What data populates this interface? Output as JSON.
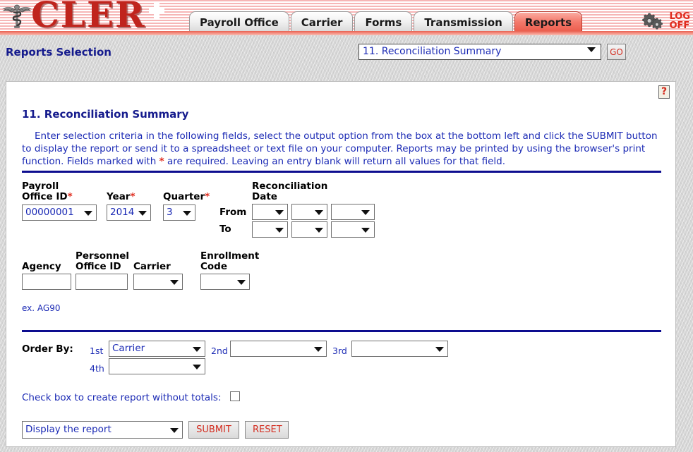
{
  "header": {
    "logo_text": "CLER",
    "caduceus_icon": "caduceus-icon",
    "tabs": [
      {
        "label": "Payroll Office",
        "active": false
      },
      {
        "label": "Carrier",
        "active": false
      },
      {
        "label": "Forms",
        "active": false
      },
      {
        "label": "Transmission",
        "active": false
      },
      {
        "label": "Reports",
        "active": true
      }
    ],
    "gears_icon": "gears-icon",
    "logoff_line1": "LOG",
    "logoff_line2": "OFF"
  },
  "subbar": {
    "title": "Reports Selection",
    "report_select_value": "11. Reconciliation Summary",
    "go_label": "GO"
  },
  "panel": {
    "help_label": "?",
    "title": "11. Reconciliation Summary",
    "intro_part1": "Enter selection criteria in the following fields, select the output option from the box at the bottom left and click the SUBMIT button to display the report or send it to a spreadsheet or text file on your computer.  Reports may be printed by using the browser's print function.  Fields marked with ",
    "intro_asterisk": "*",
    "intro_part2": " are required.  Leaving an entry blank will return all values for that field."
  },
  "criteria": {
    "payroll_office_label_line1": "Payroll",
    "payroll_office_label_line2": "Office ID",
    "payroll_office_value": "00000001",
    "year_label": "Year",
    "year_value": "2014",
    "quarter_label": "Quarter",
    "quarter_value": "3",
    "recon_date_label_line1": "Reconciliation",
    "recon_date_label_line2": "Date",
    "from_label": "From",
    "to_label": "To",
    "from_month": "",
    "from_day": "",
    "from_year": "",
    "to_month": "",
    "to_day": "",
    "to_year": "",
    "agency_label": "Agency",
    "agency_value": "",
    "personnel_label_line1": "Personnel",
    "personnel_label_line2": "Office ID",
    "personnel_value": "",
    "carrier_label": "Carrier",
    "carrier_value": "",
    "enrollment_label_line1": "Enrollment",
    "enrollment_label_line2": "Code",
    "enrollment_value": "",
    "agency_hint": "ex. AG90",
    "required_mark": "*"
  },
  "orderby": {
    "label": "Order By:",
    "first_label": "1st",
    "first_value": "Carrier",
    "second_label": "2nd",
    "second_value": "",
    "third_label": "3rd",
    "third_value": "",
    "fourth_label": "4th",
    "fourth_value": ""
  },
  "footer": {
    "checkbox_label": "Check box to create report without totals:",
    "output_value": "Display the report",
    "submit_label": "SUBMIT",
    "reset_label": "RESET"
  }
}
